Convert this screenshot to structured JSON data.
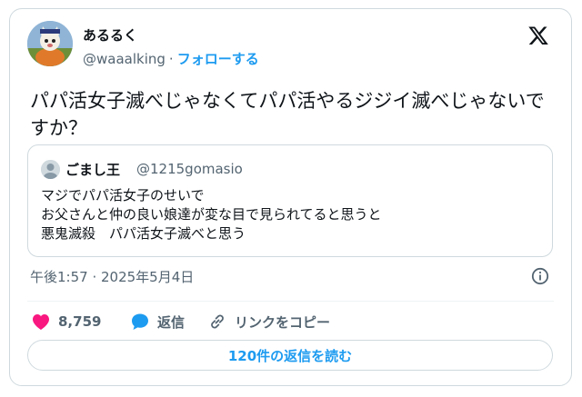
{
  "author": {
    "display_name": "あるるく",
    "handle": "@waaalking",
    "separator": "·",
    "follow_label": "フォローする"
  },
  "tweet": {
    "text": "パパ活女子滅べじゃなくてパパ活やるジジイ滅べじゃないですか？",
    "timestamp": "午後1:57 · 2025年5月4日"
  },
  "quoted_tweet": {
    "display_name": "ごまし王",
    "handle": "@1215gomasio",
    "lines": [
      "マジでパパ活女子のせいで",
      "お父さんと仲の良い娘達が変な目で見られてると思うと",
      "悪鬼滅殺　パパ活女子滅べと思う"
    ]
  },
  "actions": {
    "like_count": "8,759",
    "reply_label": "返信",
    "copy_link_label": "リンクをコピー"
  },
  "read_replies_label": "120件の返信を読む",
  "icons": {
    "x_logo": "x-logo-icon",
    "info": "info-icon",
    "like": "heart-icon",
    "reply": "speech-bubble-icon",
    "copy": "link-icon"
  },
  "colors": {
    "accent": "#1d9bf0",
    "like": "#f91880",
    "muted": "#536471",
    "border": "#cfd9de"
  }
}
